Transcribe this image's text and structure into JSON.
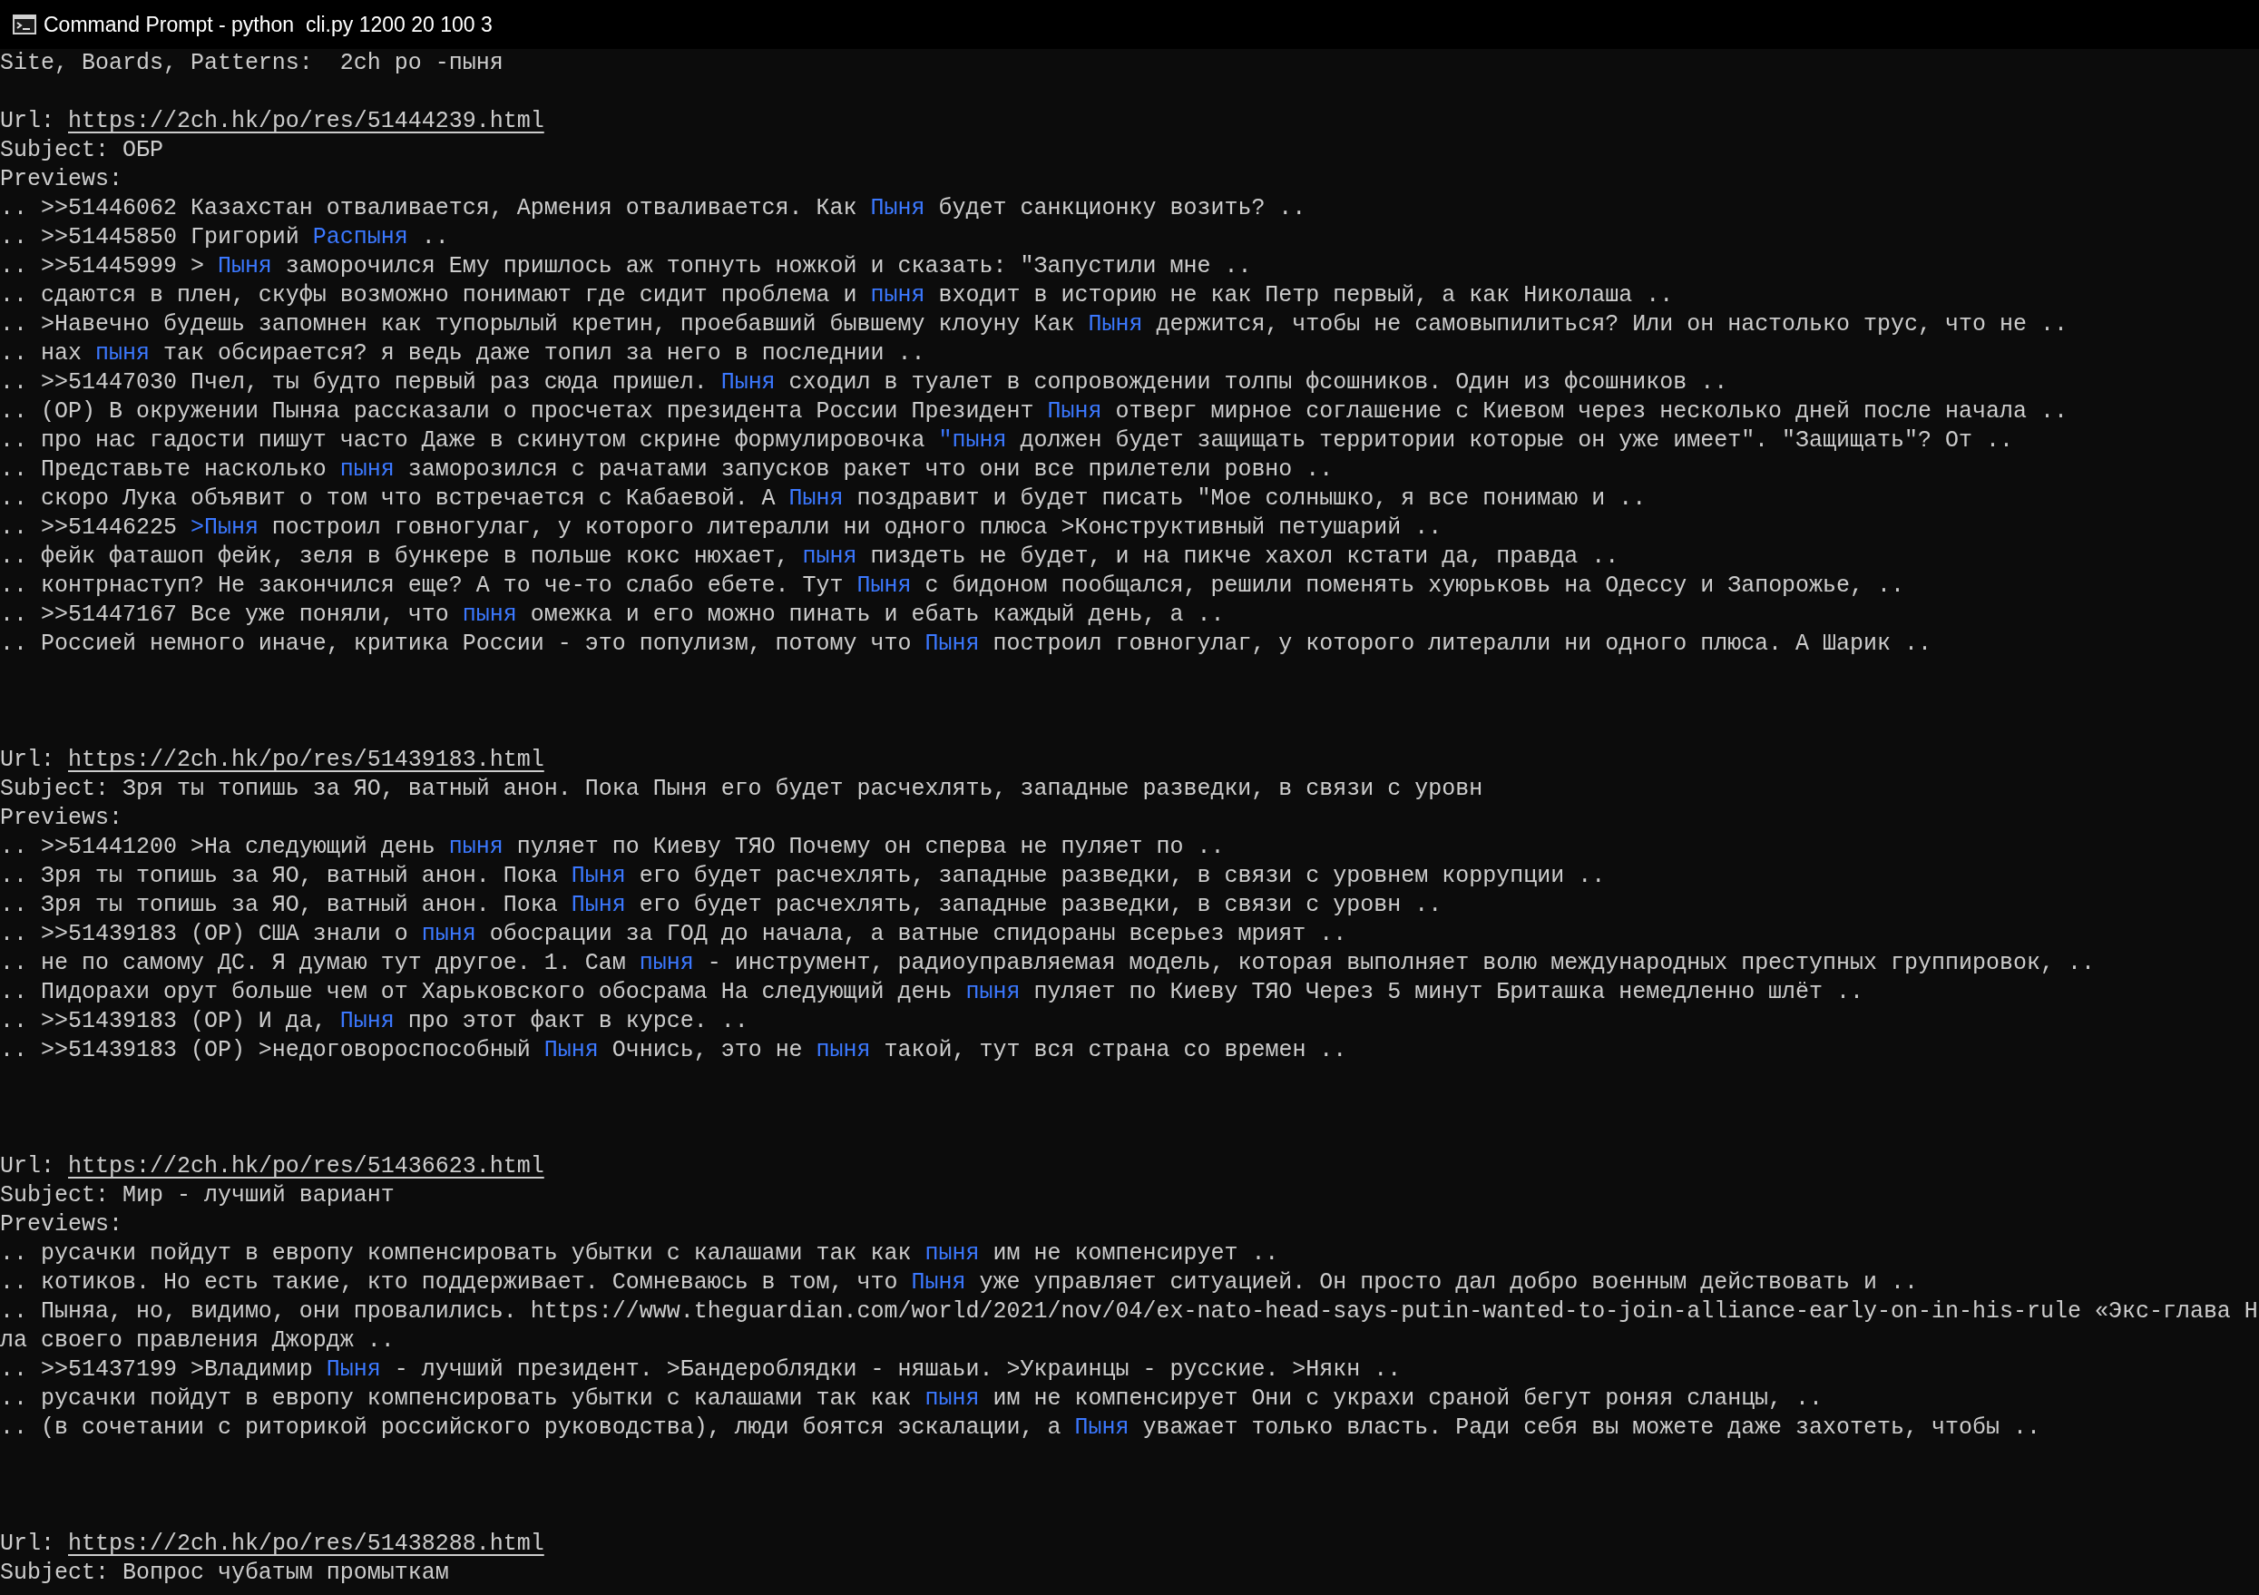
{
  "window": {
    "title": "Command Prompt - python  cli.py 1200 20 100 3"
  },
  "console": {
    "input_line": "Site, Boards, Patterns:  2ch po -пыня",
    "threads": [
      {
        "url_label": "Url:",
        "url": "https://2ch.hk/po/res/51444239.html",
        "subject_label": "Subject:",
        "subject": "ОБР",
        "previews_label": "Previews:",
        "previews": [
          [
            {
              "text": ".. >>51446062 Казахстан отваливается, Армения отваливается. Как ",
              "match": false
            },
            {
              "text": "Пыня",
              "match": true
            },
            {
              "text": " будет санкционку возить? ..",
              "match": false
            }
          ],
          [
            {
              "text": ".. >>51445850 Григорий ",
              "match": false
            },
            {
              "text": "Распыня",
              "match": true
            },
            {
              "text": " ..",
              "match": false
            }
          ],
          [
            {
              "text": ".. >>51445999 > ",
              "match": false
            },
            {
              "text": "Пыня",
              "match": true
            },
            {
              "text": " заморочился Ему пришлось аж топнуть ножкой и сказать: \"Запустили мне ..",
              "match": false
            }
          ],
          [
            {
              "text": ".. сдаются в плен, скуфы возможно понимают где сидит проблема и ",
              "match": false
            },
            {
              "text": "пыня",
              "match": true
            },
            {
              "text": " входит в историю не как Петр первый, а как Николаша ..",
              "match": false
            }
          ],
          [
            {
              "text": ".. >Навечно будешь запомнен как тупорылый кретин, проебавший бывшему клоуну Как ",
              "match": false
            },
            {
              "text": "Пыня",
              "match": true
            },
            {
              "text": " держится, чтобы не самовыпилиться? Или он настолько трус, что не ..",
              "match": false
            }
          ],
          [
            {
              "text": ".. нах ",
              "match": false
            },
            {
              "text": "пыня",
              "match": true
            },
            {
              "text": " так обсирается? я ведь даже топил за него в последнии ..",
              "match": false
            }
          ],
          [
            {
              "text": ".. >>51447030 Пчел, ты будто первый раз сюда пришел. ",
              "match": false
            },
            {
              "text": "Пыня",
              "match": true
            },
            {
              "text": " сходил в туалет в сопровождении толпы фсошников. Один из фсошников ..",
              "match": false
            }
          ],
          [
            {
              "text": ".. (ОР) В окружении Пыняа рассказали о просчетах президента России Президент ",
              "match": false
            },
            {
              "text": "Пыня",
              "match": true
            },
            {
              "text": " отверг мирное соглашение с Киевом через несколько дней после начала ..",
              "match": false
            }
          ],
          [
            {
              "text": ".. про нас гадости пишут часто Даже в скинутом скрине формулировочка ",
              "match": false
            },
            {
              "text": "\"пыня",
              "match": true
            },
            {
              "text": " должен будет защищать территории которые он уже имеет\". \"Защищать\"? От ..",
              "match": false
            }
          ],
          [
            {
              "text": ".. Представьте насколько ",
              "match": false
            },
            {
              "text": "пыня",
              "match": true
            },
            {
              "text": " заморозился с рачатами запусков ракет что они все прилетели ровно ..",
              "match": false
            }
          ],
          [
            {
              "text": ".. скоро Лука объявит о том что встречается с Кабаевой. А ",
              "match": false
            },
            {
              "text": "Пыня",
              "match": true
            },
            {
              "text": " поздравит и будет писать \"Мое солнышко, я все понимаю и ..",
              "match": false
            }
          ],
          [
            {
              "text": ".. >>51446225 ",
              "match": false
            },
            {
              "text": ">Пыня",
              "match": true
            },
            {
              "text": " построил говногулаг, у которого литералли ни одного плюса >Конструктивный петушарий ..",
              "match": false
            }
          ],
          [
            {
              "text": ".. фейк фаташоп фейк, зеля в бункере в польше кокс нюхает, ",
              "match": false
            },
            {
              "text": "пыня",
              "match": true
            },
            {
              "text": " пиздеть не будет, и на пикче хахол кстати да, правда ..",
              "match": false
            }
          ],
          [
            {
              "text": ".. контрнаступ? Не закончился еще? А то че-то слабо ебете. Тут ",
              "match": false
            },
            {
              "text": "Пыня",
              "match": true
            },
            {
              "text": " с бидоном пообщался, решили поменять хуюрьковь на Одессу и Запорожье, ..",
              "match": false
            }
          ],
          [
            {
              "text": ".. >>51447167 Все уже поняли, что ",
              "match": false
            },
            {
              "text": "пыня",
              "match": true
            },
            {
              "text": " омежка и его можно пинать и ебать каждый день, а ..",
              "match": false
            }
          ],
          [
            {
              "text": ".. Россией немного иначе, критика России - это популизм, потому что ",
              "match": false
            },
            {
              "text": "Пыня",
              "match": true
            },
            {
              "text": " построил говногулаг, у которого литералли ни одного плюса. А Шарик ..",
              "match": false
            }
          ]
        ]
      },
      {
        "url_label": "Url:",
        "url": "https://2ch.hk/po/res/51439183.html",
        "subject_label": "Subject:",
        "subject": "Зря ты топишь за ЯО, ватный анон. Пока Пыня его будет расчехлять, западные разведки, в связи с уровн",
        "previews_label": "Previews:",
        "previews": [
          [
            {
              "text": ".. >>51441200 >На следующий день ",
              "match": false
            },
            {
              "text": "пыня",
              "match": true
            },
            {
              "text": " пуляет по Киеву ТЯО Почему он сперва не пуляет по ..",
              "match": false
            }
          ],
          [
            {
              "text": ".. Зря ты топишь за ЯО, ватный анон. Пока ",
              "match": false
            },
            {
              "text": "Пыня",
              "match": true
            },
            {
              "text": " его будет расчехлять, западные разведки, в связи с уровнем коррупции ..",
              "match": false
            }
          ],
          [
            {
              "text": ".. Зря ты топишь за ЯО, ватный анон. Пока ",
              "match": false
            },
            {
              "text": "Пыня",
              "match": true
            },
            {
              "text": " его будет расчехлять, западные разведки, в связи с уровн ..",
              "match": false
            }
          ],
          [
            {
              "text": ".. >>51439183 (ОР) США знали о ",
              "match": false
            },
            {
              "text": "пыня",
              "match": true
            },
            {
              "text": " обосрации за ГОД до начала, а ватные спидораны всерьез мрият ..",
              "match": false
            }
          ],
          [
            {
              "text": ".. не по самому ДС. Я думаю тут другое. 1. Сам ",
              "match": false
            },
            {
              "text": "пыня",
              "match": true
            },
            {
              "text": " - инструмент, радиоуправляемая модель, которая выполняет волю международных преступных группировок, ..",
              "match": false
            }
          ],
          [
            {
              "text": ".. Пидорахи орут больше чем от Харьковского обосрама На следующий день ",
              "match": false
            },
            {
              "text": "пыня",
              "match": true
            },
            {
              "text": " пуляет по Киеву ТЯО Через 5 минут Бриташка немедленно шлёт ..",
              "match": false
            }
          ],
          [
            {
              "text": ".. >>51439183 (ОР) И да, ",
              "match": false
            },
            {
              "text": "Пыня",
              "match": true
            },
            {
              "text": " про этот факт в курсе. ..",
              "match": false
            }
          ],
          [
            {
              "text": ".. >>51439183 (ОР) >недоговороспособный ",
              "match": false
            },
            {
              "text": "Пыня",
              "match": true
            },
            {
              "text": " Очнись, это не ",
              "match": false
            },
            {
              "text": "пыня",
              "match": true
            },
            {
              "text": " такой, тут вся страна со времен ..",
              "match": false
            }
          ]
        ]
      },
      {
        "url_label": "Url:",
        "url": "https://2ch.hk/po/res/51436623.html",
        "subject_label": "Subject:",
        "subject": "Мир - лучший вариант",
        "previews_label": "Previews:",
        "previews": [
          [
            {
              "text": ".. русачки пойдут в европу компенсировать убытки с калашами так как ",
              "match": false
            },
            {
              "text": "пыня",
              "match": true
            },
            {
              "text": " им не компенсирует ..",
              "match": false
            }
          ],
          [
            {
              "text": ".. котиков. Но есть такие, кто поддерживает. Сомневаюсь в том, что ",
              "match": false
            },
            {
              "text": "Пыня",
              "match": true
            },
            {
              "text": " уже управляет ситуацией. Он просто дал добро военным действовать и ..",
              "match": false
            }
          ],
          [
            {
              "text": ".. Пыняа, но, видимо, они провалились. https://www.theguardian.com/world/2021/nov/04/ex-nato-head-says-putin-wanted-to-join-alliance-early-on-in-his-rule «Экс-глава Нла своего правления Джордж ..",
              "match": false
            }
          ],
          [
            {
              "text": ".. >>51437199 >Владимир ",
              "match": false
            },
            {
              "text": "Пыня",
              "match": true
            },
            {
              "text": " - лучший президент. >Бандероблядки - няшаьи. >Украинцы - русские. >Някн ..",
              "match": false
            }
          ],
          [
            {
              "text": ".. русачки пойдут в европу компенсировать убытки с калашами так как ",
              "match": false
            },
            {
              "text": "пыня",
              "match": true
            },
            {
              "text": " им не компенсирует Они с украхи сраной бегут роняя сланцы, ..",
              "match": false
            }
          ],
          [
            {
              "text": ".. (в сочетании с риторикой российского руководства), люди боятся эскалации, а ",
              "match": false
            },
            {
              "text": "Пыня",
              "match": true
            },
            {
              "text": " уважает только власть. Ради себя вы можете даже захотеть, чтобы ..",
              "match": false
            }
          ]
        ]
      },
      {
        "url_label": "Url:",
        "url": "https://2ch.hk/po/res/51438288.html",
        "subject_label": "Subject:",
        "subject": "Вопрос чубатым промыткам"
      }
    ]
  }
}
